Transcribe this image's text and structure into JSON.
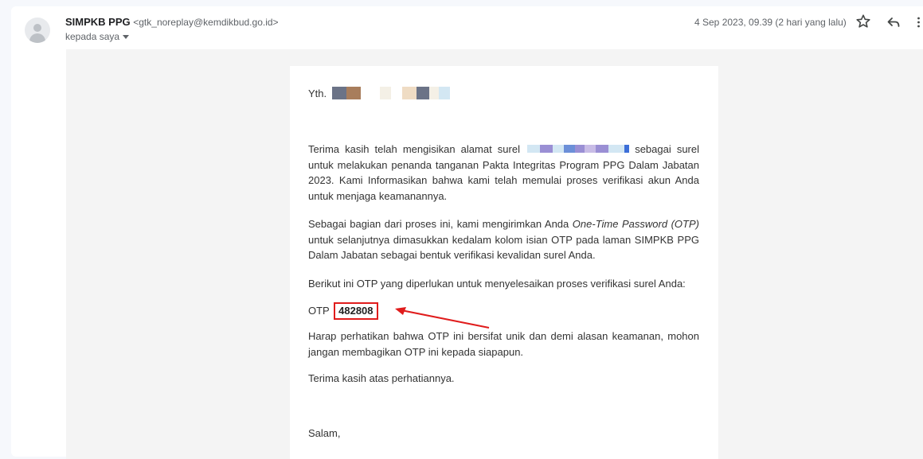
{
  "header": {
    "sender_name": "SIMPKB PPG",
    "sender_email": "<gtk_noreplay@kemdikbud.go.id>",
    "recipient_label": "kepada saya",
    "date": "4 Sep 2023, 09.39 (2 hari yang lalu)"
  },
  "icons": {
    "avatar": "person-avatar-icon",
    "star": "star-icon",
    "reply": "reply-icon",
    "more": "more-vert-icon",
    "dropdown": "caret-down-icon"
  },
  "email": {
    "greeting": "Yth.",
    "p1_before": "Terima kasih telah mengisikan alamat surel",
    "p1_after": "sebagai surel untuk melakukan penanda tanganan Pakta Integritas Program PPG Dalam Jabatan 2023. Kami Informasikan bahwa kami telah memulai proses verifikasi akun Anda untuk menjaga keamanannya.",
    "p2_before": "Sebagai bagian dari proses ini, kami mengirimkan Anda",
    "p2_italic": "One-Time Password (OTP)",
    "p2_after": "untuk selanjutnya dimasukkan kedalam kolom isian OTP pada laman SIMPKB PPG Dalam Jabatan sebagai bentuk verifikasi kevalidan surel Anda.",
    "p3": "Berikut ini OTP yang diperlukan untuk menyelesaikan proses verifikasi surel Anda:",
    "otp_label": "OTP",
    "otp_code": "482808",
    "p4": "Harap perhatikan bahwa OTP ini bersifat unik dan demi alasan keamanan, mohon jangan membagikan OTP ini kepada siapapun.",
    "p5": "Terima kasih atas perhatiannya.",
    "closing": "Salam,"
  },
  "colors": {
    "annotation_red": "#e01c1c",
    "redaction": [
      "#6b7387",
      "#a87d5c",
      "#f4f0e6",
      "#efdcc4",
      "#6b7387",
      "#d3e7f3",
      "#9a8fd4",
      "#3d6fd8",
      "#c8bce6"
    ]
  }
}
